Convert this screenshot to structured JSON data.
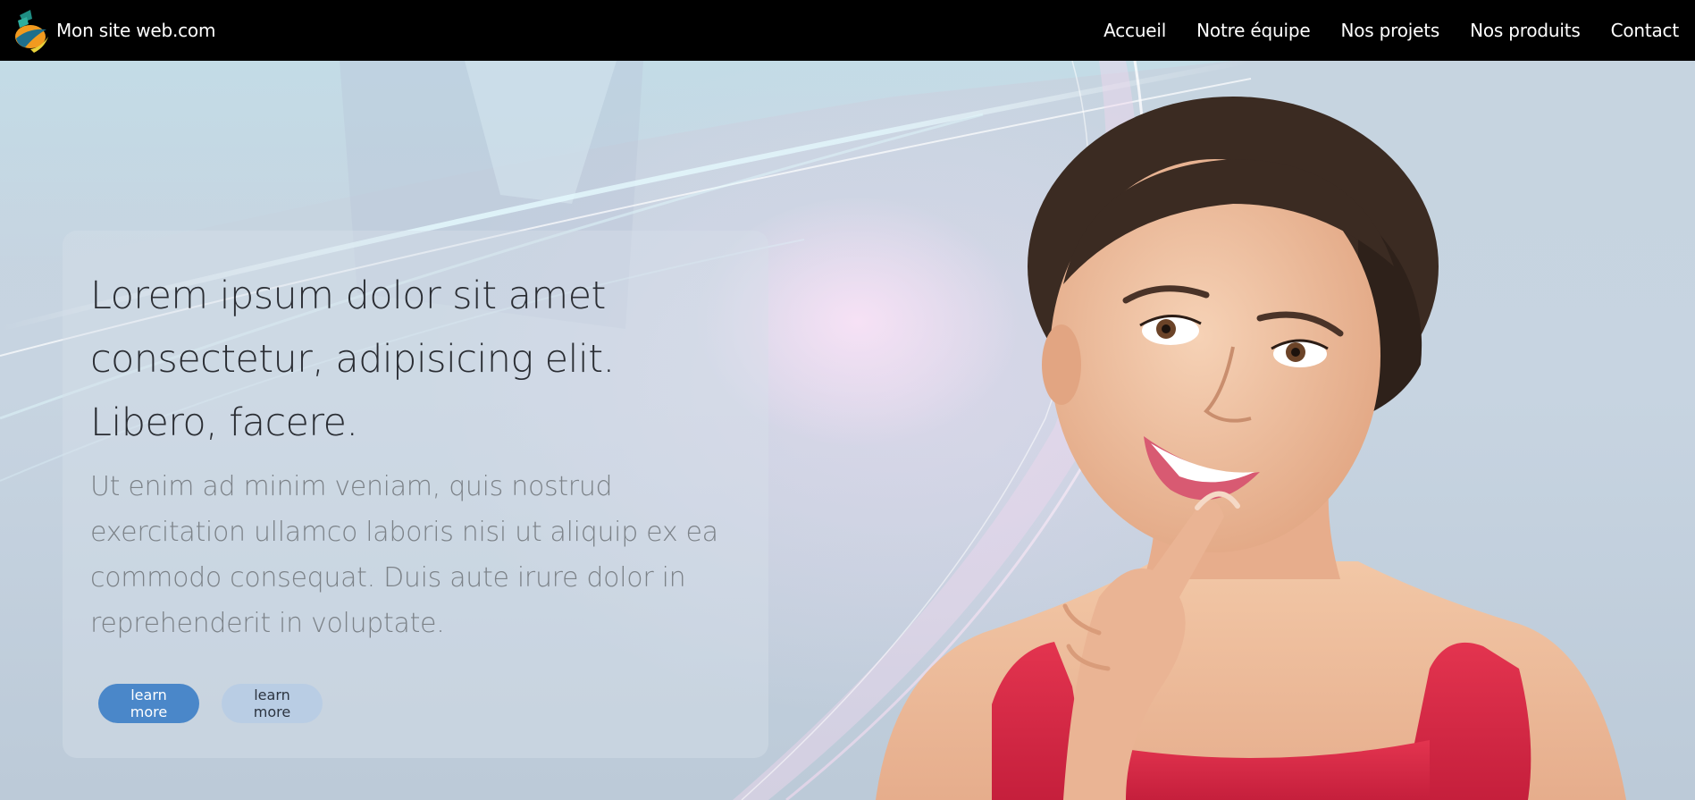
{
  "navbar": {
    "brand": "Mon site web.com",
    "logo_icon": "brand-logo-icon",
    "links": [
      "Accueil",
      "Notre équipe",
      "Nos projets",
      "Nos produits",
      "Contact"
    ]
  },
  "hero": {
    "title": "Lorem ipsum dolor sit amet consectetur, adipisicing elit. Libero, facere.",
    "text": "Ut enim ad minim veniam, quis nostrud exercitation ullamco laboris nisi ut aliquip ex ea commodo consequat. Duis aute irure dolor in reprehenderit in voluptate.",
    "buttons": {
      "primary": "learn more",
      "secondary": "learn more"
    }
  },
  "colors": {
    "navbar_bg": "#000000",
    "primary_button": "#4a87c9",
    "secondary_button": "#b9cde4",
    "top_red": "#e02a4b"
  }
}
